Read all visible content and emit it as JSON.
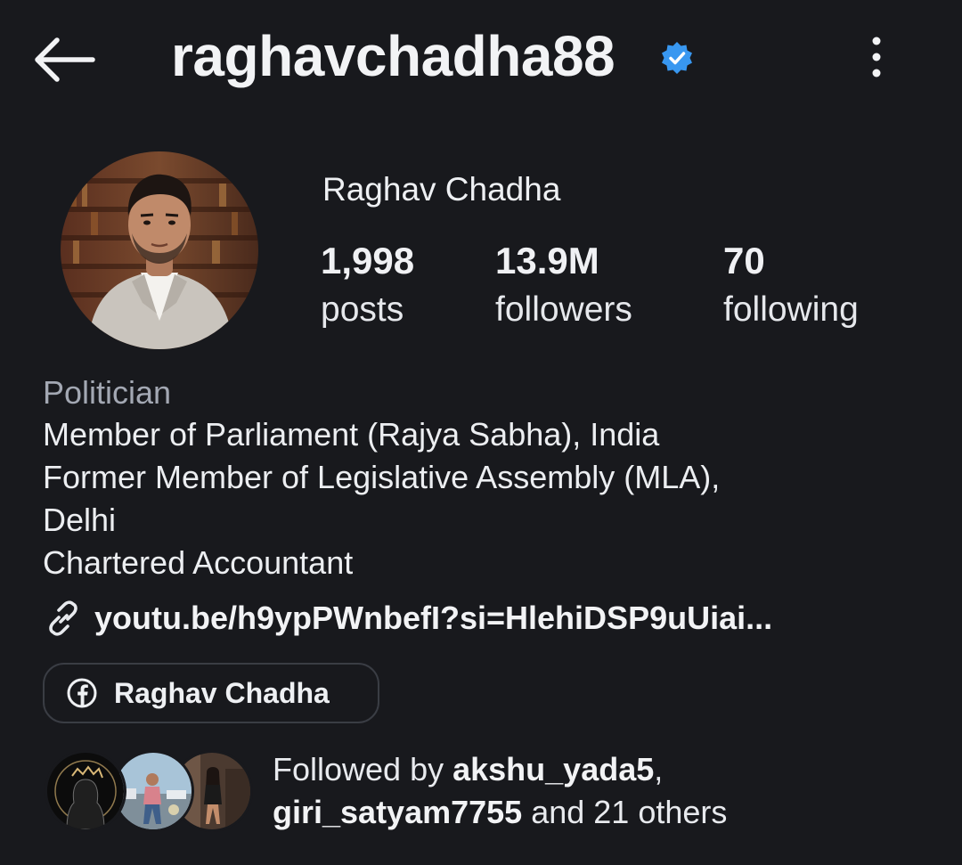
{
  "header": {
    "username": "raghavchadha88",
    "back_icon": "back-arrow-icon",
    "verified_icon": "verified-badge-icon",
    "more_icon": "more-options-icon"
  },
  "profile": {
    "full_name": "Raghav Chadha",
    "stats": {
      "posts": {
        "value": "1,998",
        "label": "posts"
      },
      "followers": {
        "value": "13.9M",
        "label": "followers"
      },
      "following": {
        "value": "70",
        "label": "following"
      }
    }
  },
  "bio": {
    "category": "Politician",
    "lines": [
      "Member of Parliament (Rajya Sabha), India",
      "Former Member of Legislative Assembly (MLA),",
      "Delhi",
      "Chartered Accountant"
    ],
    "link": "youtu.be/h9ypPWnbefI?si=HlehiDSP9uUiai..."
  },
  "facebook_chip": {
    "icon": "facebook-icon",
    "label": "Raghav Chadha"
  },
  "mutual": {
    "prefix": "Followed by ",
    "user1": "akshu_yada5",
    "comma": ",",
    "user2": "giri_satyam7755",
    "middle": " and ",
    "others": "21 others"
  },
  "colors": {
    "background": "#18191d",
    "verified_blue": "#3897f0",
    "muted_text": "#a3a8b3"
  }
}
